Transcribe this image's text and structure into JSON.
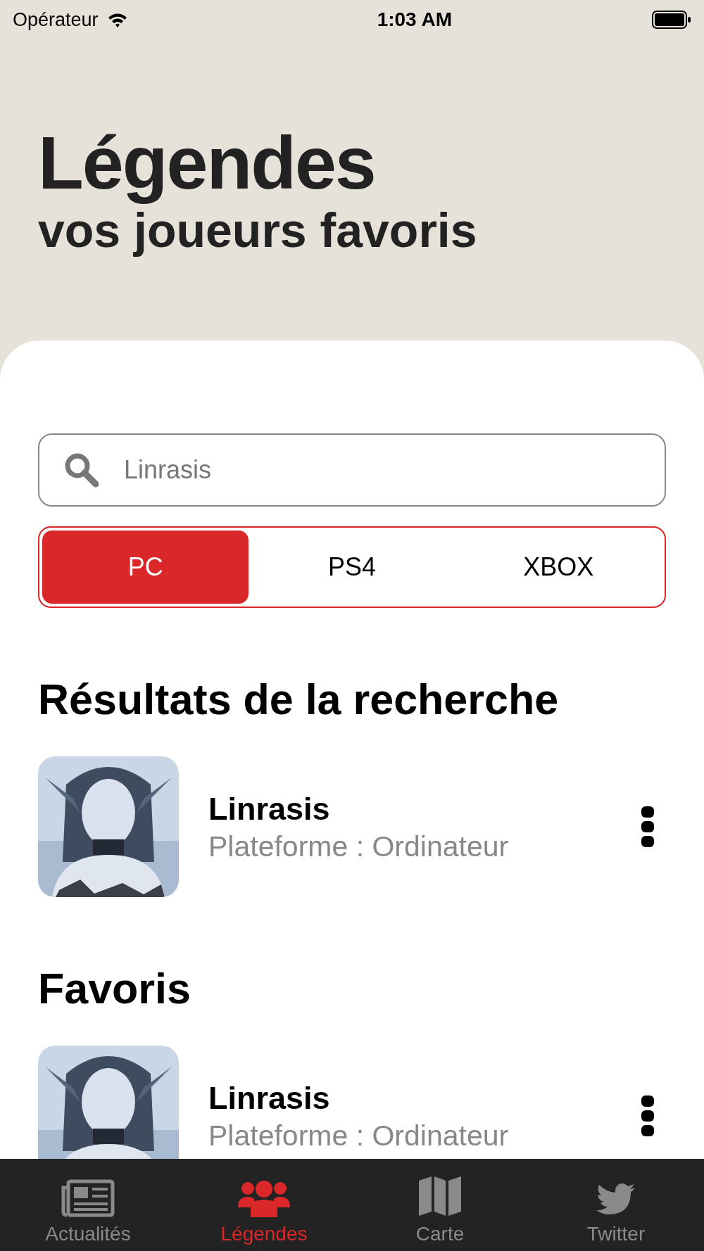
{
  "status_bar": {
    "carrier": "Opérateur",
    "time": "1:03 AM"
  },
  "header": {
    "title": "Légendes",
    "subtitle": "vos joueurs favoris"
  },
  "search": {
    "value": "Linrasis"
  },
  "segments": [
    {
      "label": "PC",
      "selected": true
    },
    {
      "label": "PS4",
      "selected": false
    },
    {
      "label": "XBOX",
      "selected": false
    }
  ],
  "sections": [
    {
      "title": "Résultats de la recherche",
      "players": [
        {
          "name": "Linrasis",
          "platform": "Plateforme : Ordinateur"
        }
      ]
    },
    {
      "title": "Favoris",
      "players": [
        {
          "name": "Linrasis",
          "platform": "Plateforme : Ordinateur"
        }
      ]
    }
  ],
  "tab_bar": [
    {
      "label": "Actualités",
      "kind": "news",
      "selected": false
    },
    {
      "label": "Légendes",
      "kind": "people",
      "selected": true
    },
    {
      "label": "Carte",
      "kind": "map",
      "selected": false
    },
    {
      "label": "Twitter",
      "kind": "bird",
      "selected": false
    }
  ]
}
